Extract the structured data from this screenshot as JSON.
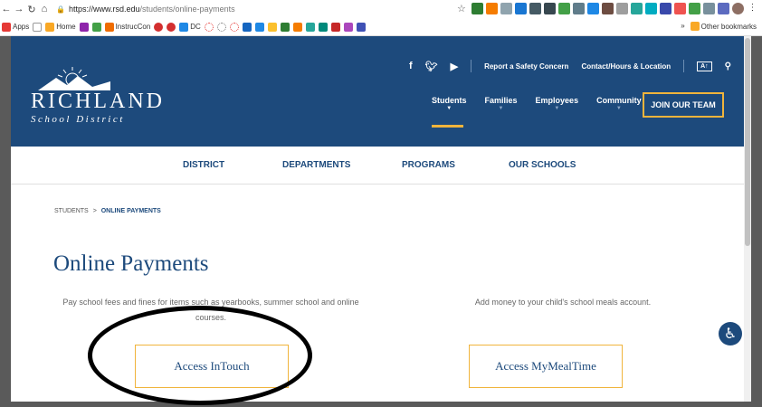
{
  "browser": {
    "url_host": "https://www.rsd.edu",
    "url_path": "/students/online-payments",
    "bookmarks": [
      "Apps",
      "Home",
      "InstrucCon",
      "DC"
    ],
    "other_bookmarks": "Other bookmarks",
    "more": "»"
  },
  "header": {
    "logo_name": "RICHLAND",
    "logo_sub": "School District",
    "top_links": [
      "Report a Safety Concern",
      "Contact/Hours & Location"
    ],
    "text_size_button": "A↑",
    "nav": [
      "Students",
      "Families",
      "Employees",
      "Community"
    ],
    "join": "JOIN OUR TEAM"
  },
  "subnav": [
    "DISTRICT",
    "DEPARTMENTS",
    "PROGRAMS",
    "OUR SCHOOLS"
  ],
  "breadcrumb": {
    "parent": "STUDENTS",
    "sep": ">",
    "current": "ONLINE PAYMENTS"
  },
  "title": "Online Payments",
  "left": {
    "desc": "Pay school fees and fines for items such as yearbooks, summer school and online courses.",
    "button": "Access InTouch"
  },
  "right": {
    "desc": "Add money to your child's school meals account.",
    "button": "Access MyMealTime"
  },
  "colors": {
    "brand": "#1d4a7c",
    "accent": "#f0b43c"
  }
}
